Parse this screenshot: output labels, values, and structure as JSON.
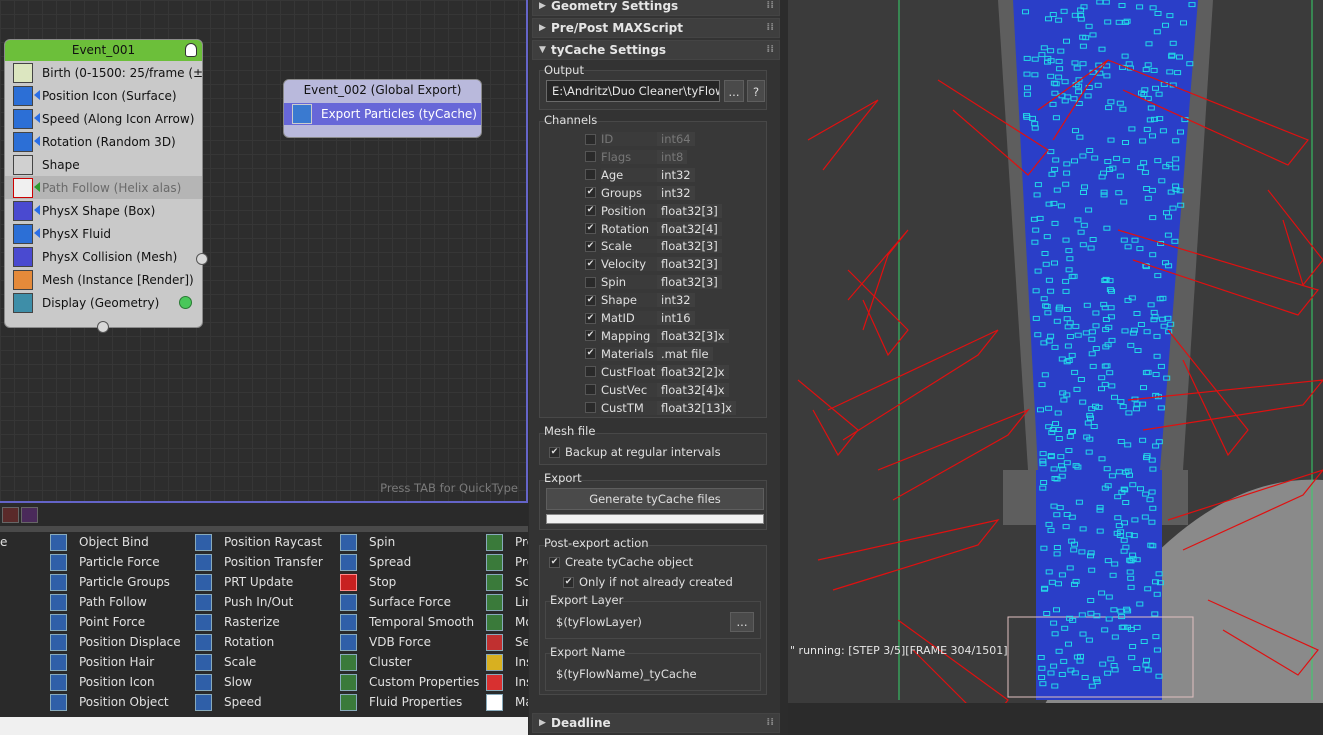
{
  "graph": {
    "hint": "Press TAB for QuickType",
    "event1": {
      "title": "Event_001",
      "rows": [
        {
          "label": "Birth (0-1500: 25/frame (±1…",
          "icon": "birth-icon"
        },
        {
          "label": "Position Icon (Surface)",
          "icon": "position-icon"
        },
        {
          "label": "Speed (Along Icon Arrow)",
          "icon": "speed-icon"
        },
        {
          "label": "Rotation (Random 3D)",
          "icon": "rotation-icon"
        },
        {
          "label": "Shape",
          "icon": "shape-icon"
        },
        {
          "label": "Path Follow (Helix alas)",
          "icon": "path-follow-icon"
        },
        {
          "label": "PhysX Shape (Box)",
          "icon": "physx-shape-icon"
        },
        {
          "label": "PhysX Fluid",
          "icon": "physx-fluid-icon"
        },
        {
          "label": "PhysX Collision (Mesh)",
          "icon": "physx-collision-icon"
        },
        {
          "label": "Mesh (Instance [Render])",
          "icon": "mesh-icon"
        },
        {
          "label": "Display (Geometry)",
          "icon": "display-icon"
        }
      ]
    },
    "event2": {
      "title": "Event_002 (Global Export)",
      "row": "Export Particles (tyCache)"
    }
  },
  "palette": {
    "col0": [
      "e"
    ],
    "col1": [
      "Object Bind",
      "Particle Force",
      "Particle Groups",
      "Path Follow",
      "Point Force",
      "Position Displace",
      "Position Hair",
      "Position Icon",
      "Position Object"
    ],
    "col2": [
      "Position Raycast",
      "Position Transfer",
      "PRT Update",
      "Push In/Out",
      "Rasterize",
      "Rotation",
      "Scale",
      "Slow",
      "Speed"
    ],
    "col3": [
      "Spin",
      "Spread",
      "Stop",
      "Surface Force",
      "Temporal Smooth",
      "VDB Force",
      "Cluster",
      "Custom Properties",
      "Fluid Properties"
    ],
    "col4": [
      "Pro",
      "Pro",
      "Scr",
      "Lin",
      "Mo",
      "Set",
      "Ins",
      "Ins",
      "Ma"
    ]
  },
  "panel": {
    "rollouts": {
      "geometry": "Geometry Settings",
      "prepost": "Pre/Post MAXScript",
      "tycache": "tyCache Settings",
      "deadline": "Deadline"
    },
    "output": {
      "label": "Output",
      "path": "E:\\Andritz\\Duo Cleaner\\tyFlow\\tyC",
      "browse": "...",
      "help": "?"
    },
    "channels": {
      "label": "Channels",
      "items": [
        {
          "name": "ID",
          "type": "int64",
          "checked": false,
          "enabled": false
        },
        {
          "name": "Flags",
          "type": "int8",
          "checked": false,
          "enabled": false
        },
        {
          "name": "Age",
          "type": "int32",
          "checked": false,
          "enabled": true
        },
        {
          "name": "Groups",
          "type": "int32",
          "checked": true,
          "enabled": true
        },
        {
          "name": "Position",
          "type": "float32[3]",
          "checked": true,
          "enabled": true
        },
        {
          "name": "Rotation",
          "type": "float32[4]",
          "checked": true,
          "enabled": true
        },
        {
          "name": "Scale",
          "type": "float32[3]",
          "checked": true,
          "enabled": true
        },
        {
          "name": "Velocity",
          "type": "float32[3]",
          "checked": true,
          "enabled": true
        },
        {
          "name": "Spin",
          "type": "float32[3]",
          "checked": false,
          "enabled": true
        },
        {
          "name": "Shape",
          "type": "int32",
          "checked": true,
          "enabled": true
        },
        {
          "name": "MatID",
          "type": "int16",
          "checked": true,
          "enabled": true
        },
        {
          "name": "Mapping",
          "type": "float32[3]x",
          "checked": true,
          "enabled": true
        },
        {
          "name": "Materials",
          "type": ".mat file",
          "checked": true,
          "enabled": true
        },
        {
          "name": "CustFloat",
          "type": "float32[2]x",
          "checked": false,
          "enabled": true
        },
        {
          "name": "CustVec",
          "type": "float32[4]x",
          "checked": false,
          "enabled": true
        },
        {
          "name": "CustTM",
          "type": "float32[13]x",
          "checked": false,
          "enabled": true
        }
      ]
    },
    "meshfile": {
      "label": "Mesh file",
      "backup": "Backup at regular intervals"
    },
    "export": {
      "label": "Export",
      "button": "Generate tyCache files"
    },
    "postexport": {
      "label": "Post-export action",
      "create": "Create tyCache object",
      "only": "Only if not already created",
      "layerLabel": "Export Layer",
      "layerValue": "$(tyFlowLayer)",
      "layerBrowse": "...",
      "nameLabel": "Export Name",
      "nameValue": "$(tyFlowName)_tyCache"
    }
  },
  "viewport": {
    "status": "\" running: [STEP 3/5][FRAME 304/1501]"
  },
  "colors": {
    "eventGreen": "#6cbf3a",
    "exportBlue": "#6767d8",
    "selection": "#6464c8",
    "wireRed": "#e01010",
    "particleCyan": "#22d8e8"
  }
}
